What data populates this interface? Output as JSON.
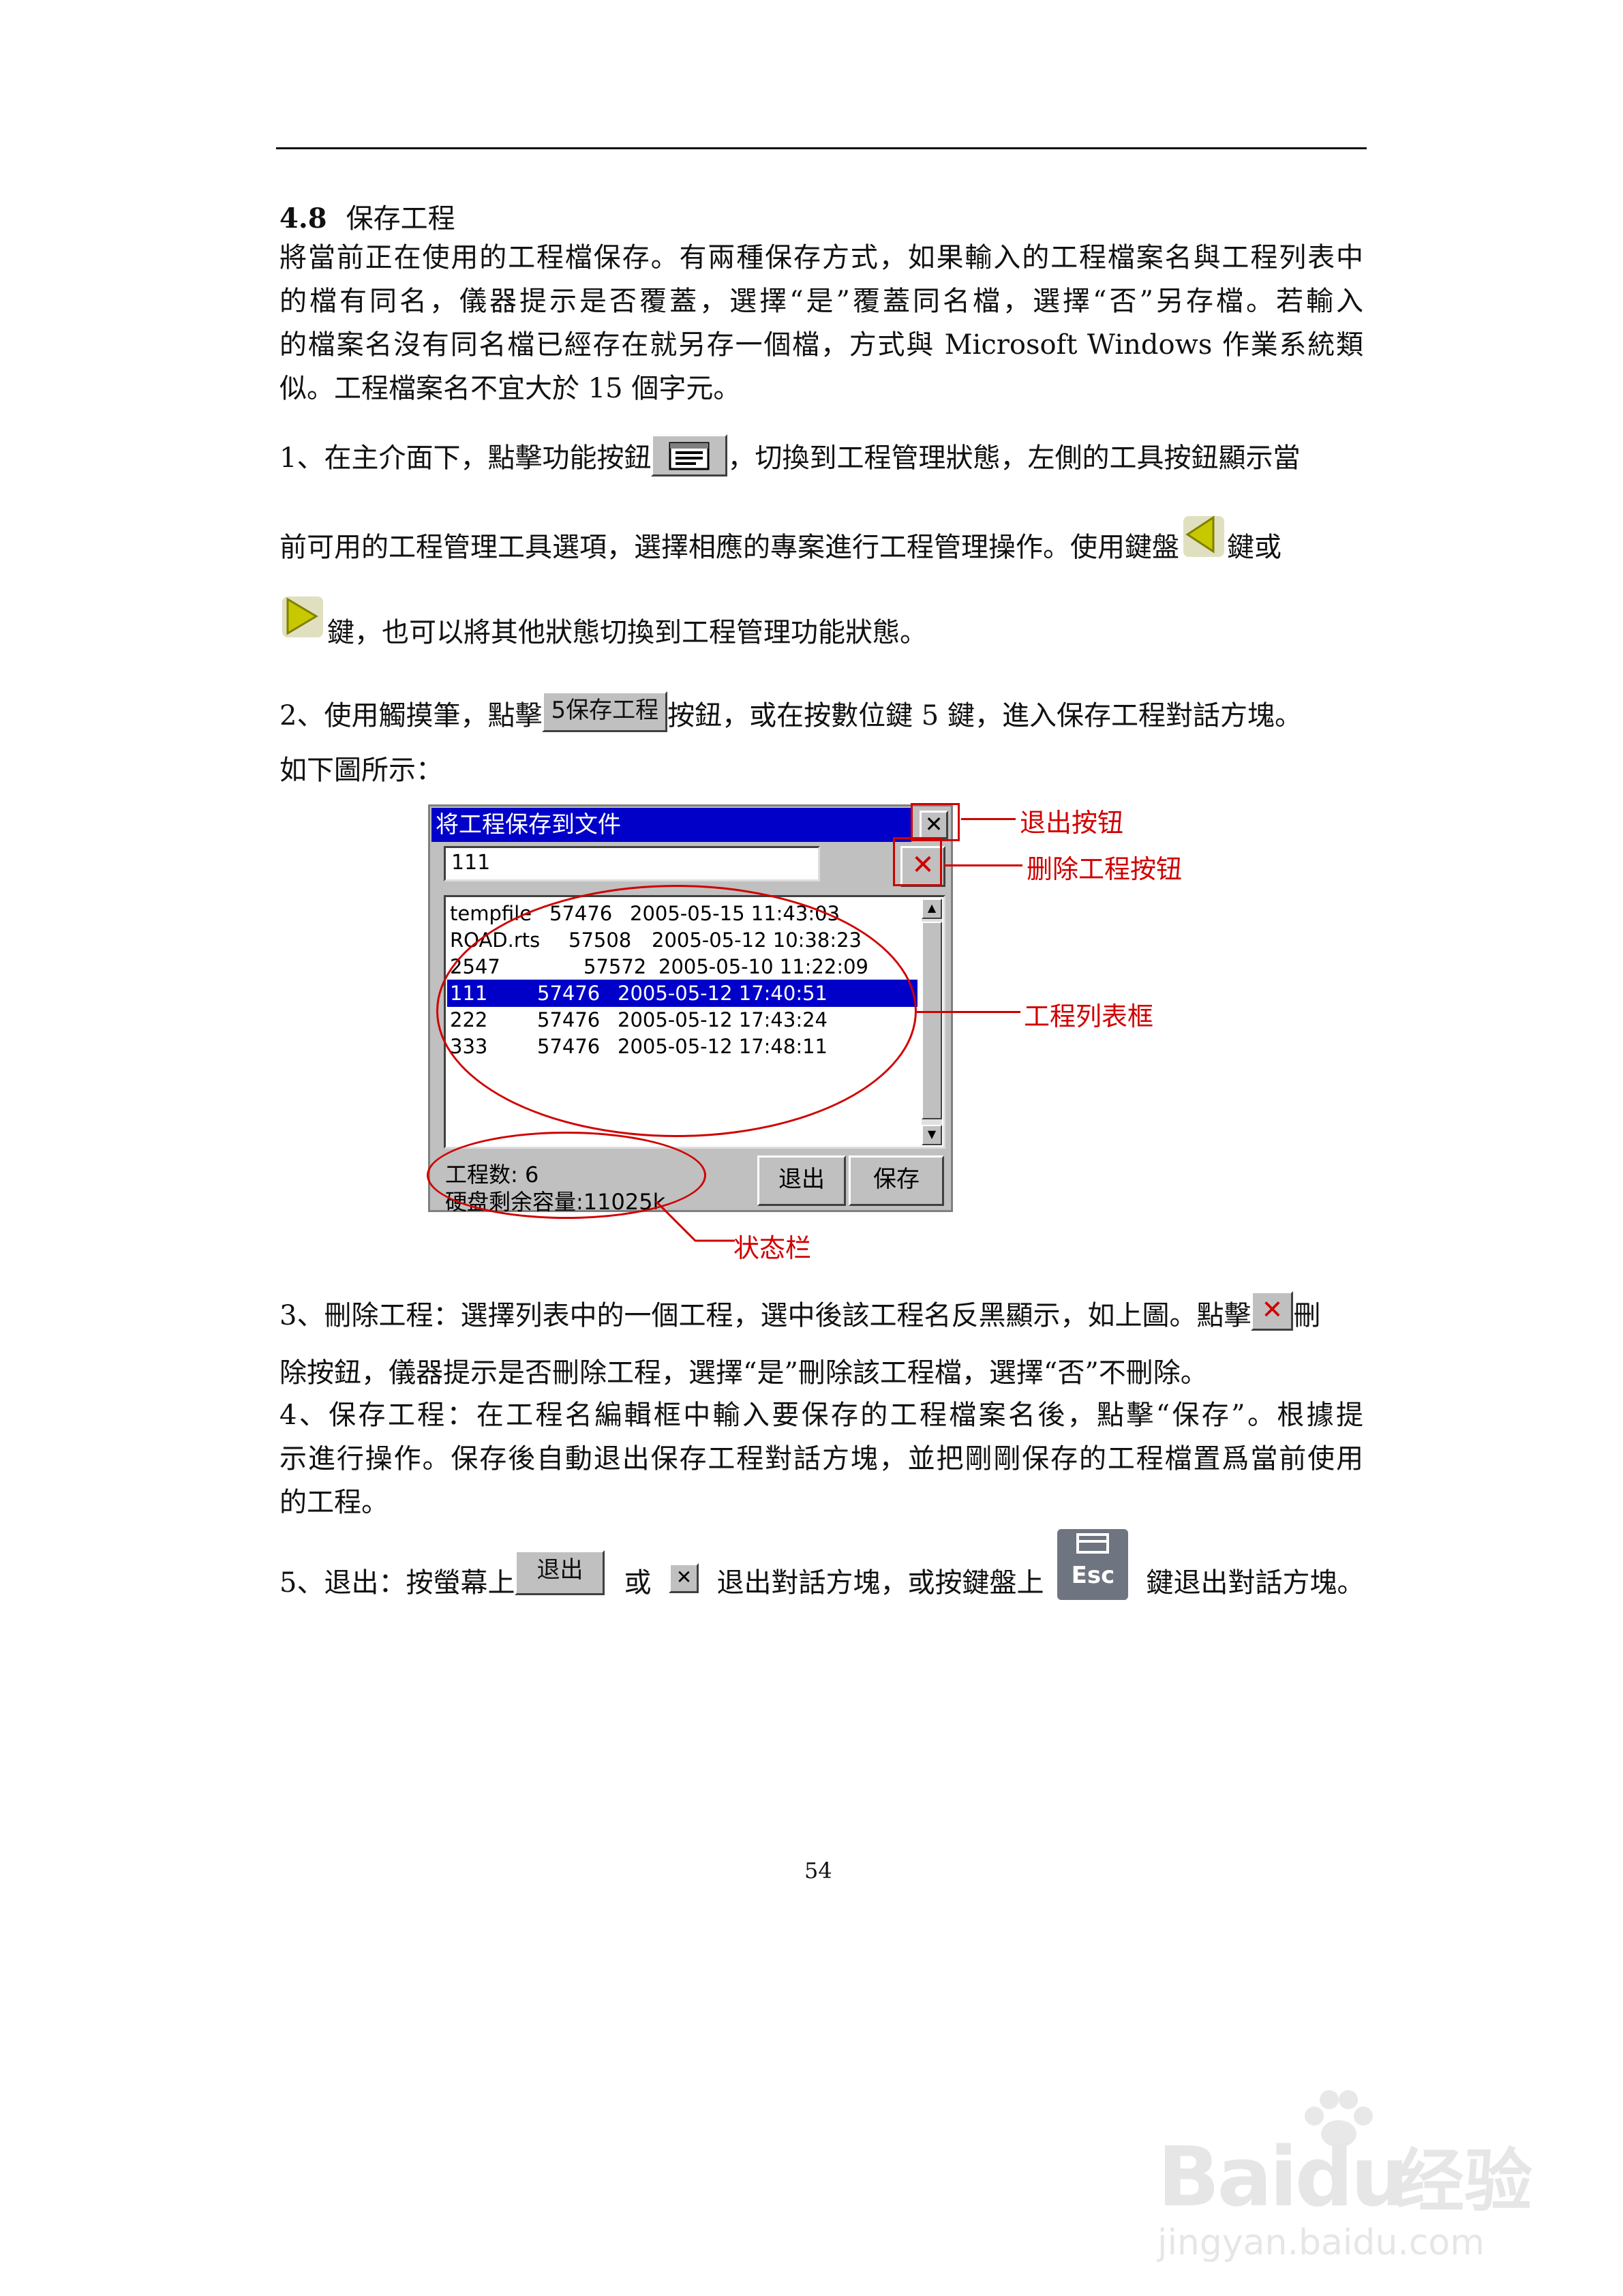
{
  "section": {
    "number": "4.8",
    "title": "保存工程"
  },
  "intro_lines": [
    "將當前正在使用的工程檔保存。有兩種保存方式，如果輸入的工程檔案名與工程列表中",
    "的檔有同名，儀器提示是否覆蓋，選擇“是”覆蓋同名檔，選擇“否”另存檔。若輸入",
    "的檔案名沒有同名檔已經存在就另存一個檔，方式與 Microsoft Windows 作業系統類",
    "似。工程檔案名不宜大於 15 個字元。"
  ],
  "step1": {
    "a": "1、在主介面下，點擊功能按鈕",
    "b": "，切換到工程管理狀態，左側的工具按鈕顯示當",
    "c": "前可用的工程管理工具選項，選擇相應的專案進行工程管理操作。使用鍵盤",
    "d": "鍵或",
    "e": "鍵，也可以將其他狀態切換到工程管理功能狀態。"
  },
  "step2": {
    "a": "2、使用觸摸筆，點擊",
    "button": "5保存工程",
    "b": "按鈕，或在按數位鍵 5 鍵，進入保存工程對話方塊。",
    "c": "如下圖所示："
  },
  "dialog": {
    "title": "将工程保存到文件",
    "close_glyph": "✕",
    "input_value": "111",
    "delete_glyph": "✕",
    "files": [
      {
        "name": "tempfile",
        "size": "57476",
        "date": "2005-05-15 11:43:03",
        "selected": false
      },
      {
        "name": "ROAD.rts",
        "size": "57508",
        "date": "2005-05-12 10:38:23",
        "selected": false
      },
      {
        "name": "2547",
        "size": "57572",
        "date": "2005-05-10 11:22:09",
        "selected": false
      },
      {
        "name": "111",
        "size": "57476",
        "date": "2005-05-12 17:40:51",
        "selected": true
      },
      {
        "name": "222",
        "size": "57476",
        "date": "2005-05-12 17:43:24",
        "selected": false
      },
      {
        "name": "333",
        "size": "57476",
        "date": "2005-05-12 17:48:11",
        "selected": false
      }
    ],
    "status_count": "工程数:  6",
    "status_disk": "硬盘剩余容量:11025k",
    "exit_button": "退出",
    "save_button": "保存"
  },
  "callouts": {
    "exit": "退出按钮",
    "delete": "删除工程按钮",
    "list": "工程列表框",
    "status": "状态栏"
  },
  "step3": {
    "a": "3、刪除工程：選擇列表中的一個工程，選中後該工程名反黑顯示，如上圖。點擊",
    "b": "刪",
    "c": "除按鈕，儀器提示是否刪除工程，選擇“是”刪除該工程檔，選擇“否”不刪除。"
  },
  "step4": [
    "4、保存工程：在工程名編輯框中輸入要保存的工程檔案名後，點擊“保存”。根據提",
    "示進行操作。保存後自動退出保存工程對話方塊，並把剛剛保存的工程檔置爲當前使用",
    "的工程。"
  ],
  "step5": {
    "a": "5、退出：按螢幕上",
    "button": "退出",
    "b": "或",
    "c": "退出對話方塊，或按鍵盤上",
    "esc": "Esc",
    "d": "鍵退出對話方塊。"
  },
  "page_number": "54",
  "watermark": {
    "logo": "Bai",
    "logo2": "du",
    "cn": "经验",
    "url": "jingyan.baidu.com"
  }
}
